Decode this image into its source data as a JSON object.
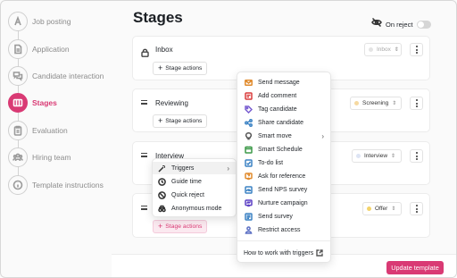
{
  "sidebar": {
    "items": [
      {
        "label": "Job posting",
        "icon": "font-a-icon",
        "active": false
      },
      {
        "label": "Application",
        "icon": "document-icon",
        "active": false
      },
      {
        "label": "Candidate interaction",
        "icon": "chat-bubbles-icon",
        "active": false
      },
      {
        "label": "Stages",
        "icon": "columns-icon",
        "active": true
      },
      {
        "label": "Evaluation",
        "icon": "clipboard-icon",
        "active": false
      },
      {
        "label": "Hiring team",
        "icon": "team-icon",
        "active": false
      },
      {
        "label": "Template instructions",
        "icon": "info-icon",
        "active": false
      }
    ]
  },
  "header": {
    "title": "Stages",
    "on_reject_label": "On reject",
    "on_reject_enabled": false
  },
  "stages": [
    {
      "name": "Inbox",
      "select": "Inbox",
      "locked": true,
      "dot_color": "#e4e4e4"
    },
    {
      "name": "Reviewing",
      "select": "Screening",
      "locked": false,
      "dot_color": "#f6d9a0"
    },
    {
      "name": "Interview",
      "select": "Interview",
      "locked": false,
      "dot_color": "#dde4f4"
    },
    {
      "name": "",
      "select": "Offer",
      "locked": false,
      "dot_color": "#f3d36a"
    }
  ],
  "stage_actions_label": "Stage actions",
  "stage_actions_menu": {
    "items": [
      {
        "label": "Triggers",
        "icon": "magic-wand-icon",
        "submenu": true
      },
      {
        "label": "Guide time",
        "icon": "clock-icon"
      },
      {
        "label": "Quick reject",
        "icon": "block-icon"
      },
      {
        "label": "Anonymous mode",
        "icon": "incognito-icon"
      }
    ]
  },
  "triggers_menu": {
    "items": [
      {
        "label": "Send message",
        "icon": "envelope-icon",
        "color": "#e08a2c"
      },
      {
        "label": "Add comment",
        "icon": "comment-icon",
        "color": "#d93a3a"
      },
      {
        "label": "Tag candidate",
        "icon": "tag-icon",
        "color": "#7a5fd1"
      },
      {
        "label": "Share candidate",
        "icon": "share-icon",
        "color": "#3b82c4"
      },
      {
        "label": "Smart move",
        "icon": "lightbulb-icon",
        "color": "#555555",
        "submenu": true
      },
      {
        "label": "Smart Schedule",
        "icon": "calendar-icon",
        "color": "#3e9a4a"
      },
      {
        "label": "To-do list",
        "icon": "checkbox-icon",
        "color": "#3b82c4"
      },
      {
        "label": "Ask for reference",
        "icon": "question-bubble-icon",
        "color": "#e08a2c"
      },
      {
        "label": "Send NPS survey",
        "icon": "gauge-icon",
        "color": "#3b82c4"
      },
      {
        "label": "Nurture campaign",
        "icon": "campaign-icon",
        "color": "#5b3fc4"
      },
      {
        "label": "Send survey",
        "icon": "survey-icon",
        "color": "#3b82c4"
      },
      {
        "label": "Restrict access",
        "icon": "restricted-user-icon",
        "color": "#5b6fc4"
      }
    ],
    "help_link": "How to work with triggers"
  },
  "footer": {
    "update_button": "Update template"
  },
  "colors": {
    "accent": "#d93a74",
    "accent_soft": "#fbe9f0"
  }
}
